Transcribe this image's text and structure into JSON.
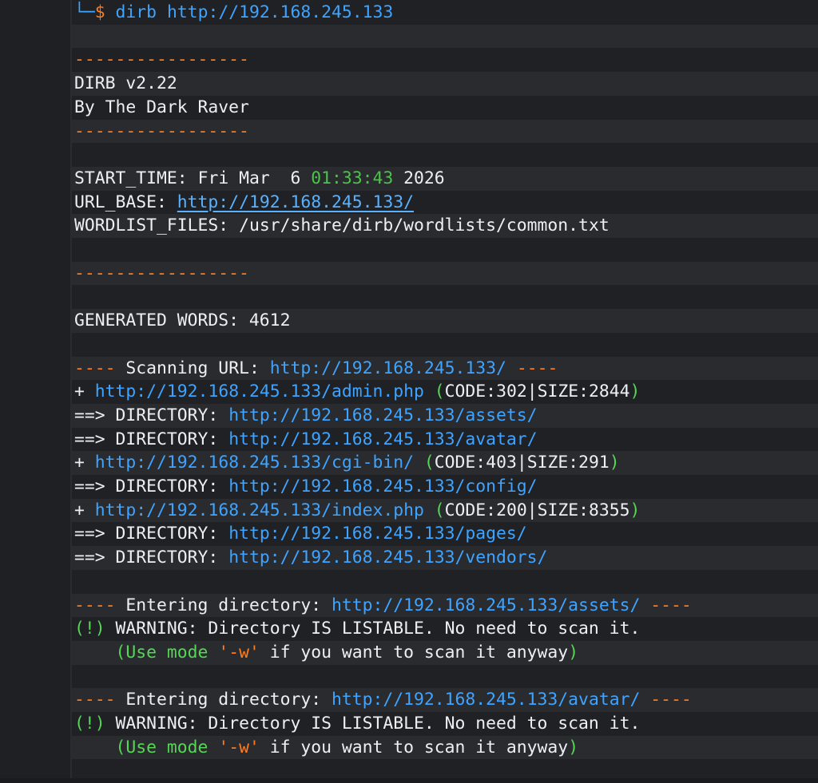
{
  "prompt": {
    "corner": "└─",
    "dollar": "$",
    "command": "dirb",
    "url": "http://192.168.245.133"
  },
  "banner": {
    "rule": "-----------------",
    "version": "DIRB v2.22",
    "author": "By The Dark Raver"
  },
  "info": {
    "start_label": "START_TIME:",
    "start_date": "Fri Mar  6",
    "start_clock": "01:33:43",
    "start_year": "2026",
    "url_base_label": "URL_BASE:",
    "url_base": "http://192.168.245.133/",
    "wordlist_label": "WORDLIST_FILES:",
    "wordlist": "/usr/share/dirb/wordlists/common.txt"
  },
  "generated": "GENERATED WORDS: 4612",
  "scan_header": {
    "dashes": "----",
    "label": "Scanning URL:",
    "url": "http://192.168.245.133/"
  },
  "results": [
    {
      "prefix": "+",
      "url": "http://192.168.245.133/admin.php",
      "open": "(",
      "info": "CODE:302|SIZE:2844",
      "close": ")"
    },
    {
      "prefix": "==> DIRECTORY:",
      "url": "http://192.168.245.133/assets/"
    },
    {
      "prefix": "==> DIRECTORY:",
      "url": "http://192.168.245.133/avatar/"
    },
    {
      "prefix": "+",
      "url": "http://192.168.245.133/cgi-bin/",
      "open": "(",
      "info": "CODE:403|SIZE:291",
      "close": ")"
    },
    {
      "prefix": "==> DIRECTORY:",
      "url": "http://192.168.245.133/config/"
    },
    {
      "prefix": "+",
      "url": "http://192.168.245.133/index.php",
      "open": "(",
      "info": "CODE:200|SIZE:8355",
      "close": ")"
    },
    {
      "prefix": "==> DIRECTORY:",
      "url": "http://192.168.245.133/pages/"
    },
    {
      "prefix": "==> DIRECTORY:",
      "url": "http://192.168.245.133/vendors/"
    }
  ],
  "entering": [
    {
      "dashes": "----",
      "label": "Entering directory:",
      "url": "http://192.168.245.133/assets/",
      "warn_mark": "(!)",
      "warning": "WARNING: Directory IS LISTABLE. No need to scan it.",
      "hint_open": "(Use mode",
      "hint_flag": "'-w'",
      "hint_rest": "if you want to scan it anyway",
      "hint_close": ")"
    },
    {
      "dashes": "----",
      "label": "Entering directory:",
      "url": "http://192.168.245.133/avatar/",
      "warn_mark": "(!)",
      "warning": "WARNING: Directory IS LISTABLE. No need to scan it.",
      "hint_open": "(Use mode",
      "hint_flag": "'-w'",
      "hint_rest": "if you want to scan it anyway",
      "hint_close": ")"
    }
  ]
}
